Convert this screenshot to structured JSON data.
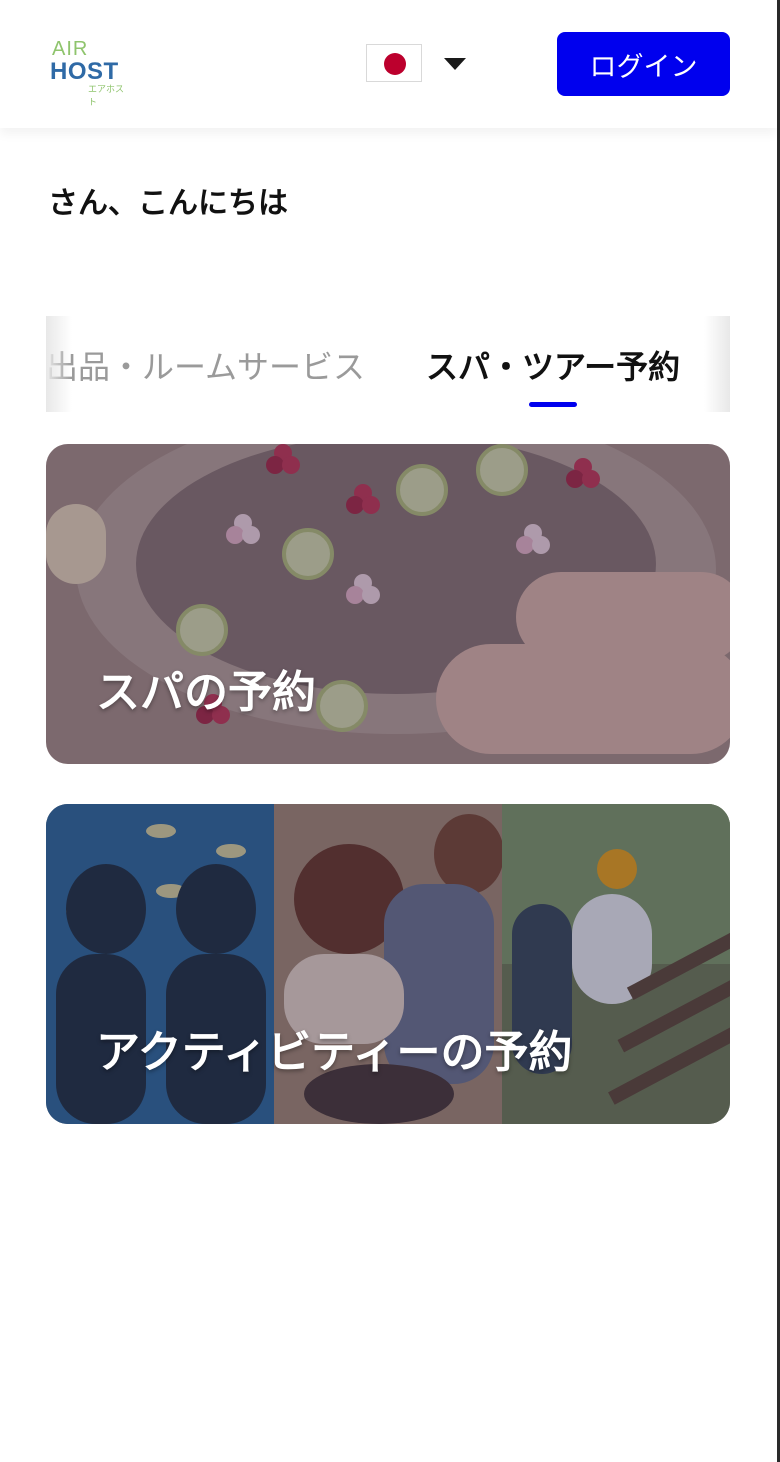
{
  "header": {
    "logo": {
      "top": "AIR",
      "main": "HOST",
      "kana": "エアホスト"
    },
    "language": {
      "flag_icon": "japan-flag-icon",
      "dropdown_icon": "caret-down-icon"
    },
    "login_label": "ログイン"
  },
  "greeting": "さん、こんにちは",
  "tabs": [
    {
      "label": "出品・ルームサービス",
      "active": false
    },
    {
      "label": "スパ・ツアー予約",
      "active": true
    }
  ],
  "cards": [
    {
      "title": "スパの予約",
      "image": "spa-footbath-image"
    },
    {
      "title": "アクティビティーの予約",
      "image": "activities-collage-image"
    }
  ],
  "colors": {
    "accent": "#0000ee",
    "tab_inactive": "#9a9a9a",
    "text": "#111111"
  }
}
